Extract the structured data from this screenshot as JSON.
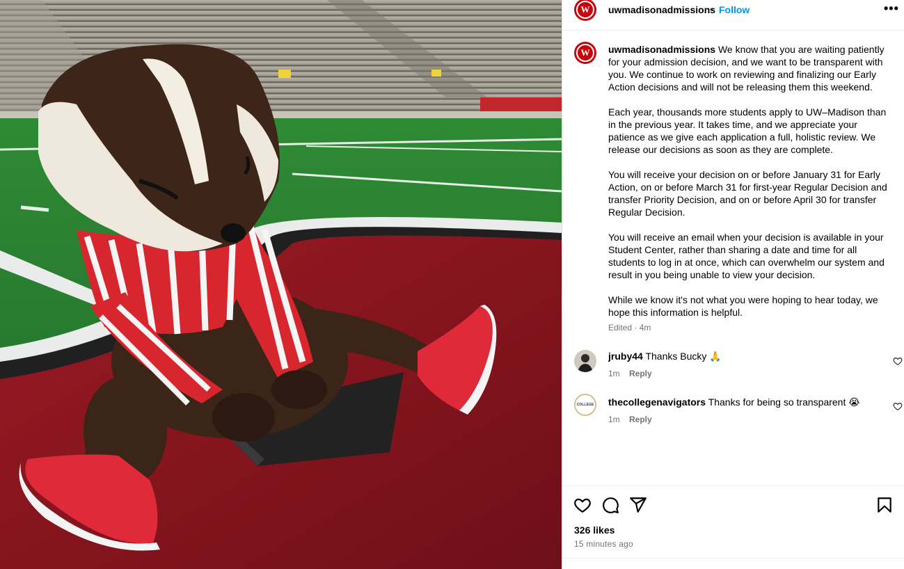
{
  "post": {
    "username": "uwmadisonadmissions",
    "separator": "•",
    "follow_label": "Follow",
    "more_label": "•••",
    "avatar_letter": "W",
    "caption": {
      "username": "uwmadisonadmissions",
      "paragraphs": [
        "We know that you are waiting patiently for your admission decision, and we want to be transparent with you. We continue to work on reviewing and finalizing our Early Action decisions and will not be releasing them this weekend.",
        "Each year, thousands more students apply to UW–Madison than in the previous year. It takes time, and we appreciate your patience as we give each application a full, holistic review. We release our decisions as soon as they are complete.",
        "You will receive your decision on or before January 31 for Early Action, on or before March 31 for first-year Regular Decision and transfer Priority Decision, and on or before April 30 for transfer Regular Decision.",
        "You will receive an email when your decision is available in your Student Center, rather than sharing a date and time for all students to log in at once, which can overwhelm our system and result in you being unable to view your decision.",
        "While we know it's not what you were hoping to hear today, we hope this information is helpful."
      ],
      "edited": "Edited · 4m"
    },
    "comments": [
      {
        "username": "jruby44",
        "text": "Thanks Bucky 🙏",
        "time": "1m",
        "reply_label": "Reply"
      },
      {
        "username": "thecollegenavigators",
        "text": "Thanks for being so transparent 😭",
        "time": "1m",
        "reply_label": "Reply",
        "avatar_text": "COLLEGE"
      }
    ],
    "likes": "326 likes",
    "posted": "15 minutes ago"
  },
  "colors": {
    "accent": "#0095f6",
    "brand": "#c5050c",
    "muted": "#737373"
  },
  "icons": [
    "heart-icon",
    "comment-icon",
    "share-icon",
    "bookmark-icon",
    "more-icon"
  ]
}
